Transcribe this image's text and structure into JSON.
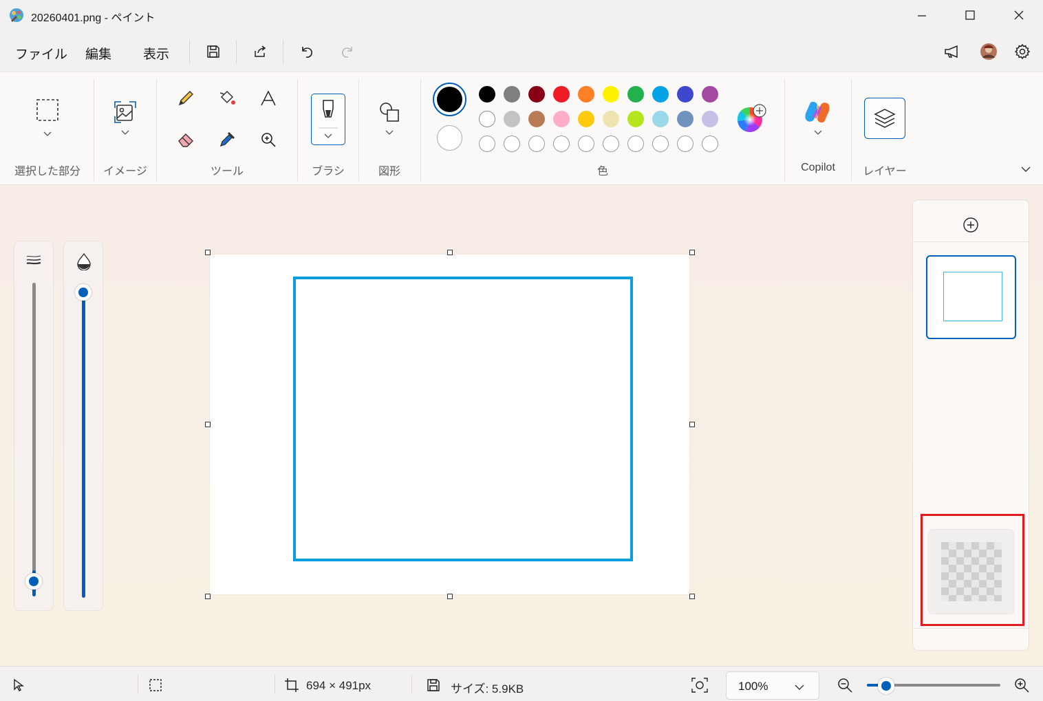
{
  "window": {
    "title": "20260401.png - ペイント"
  },
  "menu": {
    "file": "ファイル",
    "edit": "編集",
    "view": "表示"
  },
  "ribbon": {
    "groups": {
      "selection": "選択した部分",
      "image": "イメージ",
      "tools": "ツール",
      "brush": "ブラシ",
      "shapes": "図形",
      "colors": "色",
      "copilot": "Copilot",
      "layers": "レイヤー"
    },
    "primary_color": "#000000",
    "secondary_color": "#ffffff",
    "palette_row1": [
      "#000000",
      "#7f7f7f",
      "#880015",
      "#ed1c24",
      "#ff7f27",
      "#fff200",
      "#22b14c",
      "#00a2e8",
      "#3f48cc",
      "#a349a4"
    ],
    "palette_row2": [
      "#ffffff",
      "#c3c3c3",
      "#b97a57",
      "#ffaec9",
      "#ffc90e",
      "#efe4b0",
      "#b5e61d",
      "#99d9ea",
      "#7092be",
      "#c8bfe7"
    ],
    "palette_row3_count": 10
  },
  "canvas": {
    "rect_color": "#0a9ede"
  },
  "status": {
    "dimensions": "694 × 491px",
    "size": "サイズ: 5.9KB",
    "zoom": "100%"
  },
  "icons": {
    "select": "select-icon",
    "image": "image-icon",
    "pencil": "pencil-icon",
    "fill": "fill-icon",
    "text": "text-icon",
    "eraser": "eraser-icon",
    "picker": "color-picker-icon",
    "magnifier": "magnifier-icon",
    "brush": "brush-icon",
    "shapes": "shapes-icon",
    "copilot": "copilot-icon",
    "layers": "layers-icon"
  },
  "accent_color": "#005fb8",
  "highlight_color": "#e11b22"
}
